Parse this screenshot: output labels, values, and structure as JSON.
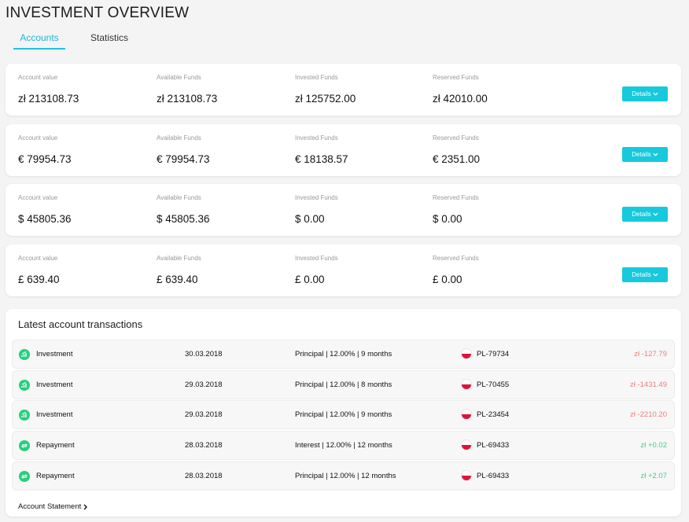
{
  "header": {
    "title": "INVESTMENT OVERVIEW"
  },
  "tabs": [
    {
      "label": "Accounts",
      "active": true
    },
    {
      "label": "Statistics",
      "active": false
    }
  ],
  "accounts": [
    {
      "currency": "PLN",
      "account_value_label": "Account value",
      "account_value": "zł 213108.73",
      "available_label": "Available Funds",
      "available": "zł 213108.73",
      "invested_label": "Invested Funds",
      "invested": "zł 125752.00",
      "reserved_label": "Reserved Funds",
      "reserved": "zł 42010.00",
      "details_label": "Details"
    },
    {
      "currency": "EUR",
      "account_value_label": "Account value",
      "account_value": "€ 79954.73",
      "available_label": "Available Funds",
      "available": "€ 79954.73",
      "invested_label": "Invested Funds",
      "invested": "€ 18138.57",
      "reserved_label": "Reserved Funds",
      "reserved": "€ 2351.00",
      "details_label": "Details"
    },
    {
      "currency": "USD",
      "account_value_label": "Account value",
      "account_value": "$ 45805.36",
      "available_label": "Available Funds",
      "available": "$ 45805.36",
      "invested_label": "Invested Funds",
      "invested": "$ 0.00",
      "reserved_label": "Reserved Funds",
      "reserved": "$ 0.00",
      "details_label": "Details"
    },
    {
      "currency": "GBP",
      "account_value_label": "Account value",
      "account_value": "£ 639.40",
      "available_label": "Available Funds",
      "available": "£ 639.40",
      "invested_label": "Invested Funds",
      "invested": "£ 0.00",
      "reserved_label": "Reserved Funds",
      "reserved": "£ 0.00",
      "details_label": "Details"
    }
  ],
  "transactions": {
    "title": "Latest account transactions",
    "rows": [
      {
        "icon": "investment-icon",
        "type": "Investment",
        "date": "30.03.2018",
        "description": "Principal | 12.00% | 9 months",
        "flag": "poland-flag-icon",
        "loan": "PL-79734",
        "amount": "zł -127.79",
        "sign": "neg"
      },
      {
        "icon": "investment-icon",
        "type": "Investment",
        "date": "29.03.2018",
        "description": "Principal | 12.00% | 8 months",
        "flag": "poland-flag-icon",
        "loan": "PL-70455",
        "amount": "zł -1431.49",
        "sign": "neg"
      },
      {
        "icon": "investment-icon",
        "type": "Investment",
        "date": "29.03.2018",
        "description": "Principal | 12.00% | 9 months",
        "flag": "poland-flag-icon",
        "loan": "PL-23454",
        "amount": "zł -2210.20",
        "sign": "neg"
      },
      {
        "icon": "repayment-icon",
        "type": "Repayment",
        "date": "28.03.2018",
        "description": "Interest | 12.00% | 12 months",
        "flag": "poland-flag-icon",
        "loan": "PL-69433",
        "amount": "zł +0.02",
        "sign": "pos"
      },
      {
        "icon": "repayment-icon",
        "type": "Repayment",
        "date": "28.03.2018",
        "description": "Principal | 12.00% | 12 months",
        "flag": "poland-flag-icon",
        "loan": "PL-69433",
        "amount": "zł +2.07",
        "sign": "pos"
      }
    ],
    "statement_link": "Account Statement"
  },
  "colors": {
    "accent": "#16c9dc",
    "tab_active": "#1cb8d8",
    "positive": "#3fcf86",
    "negative": "#f07b7b",
    "icon_green": "#27cf7e"
  }
}
